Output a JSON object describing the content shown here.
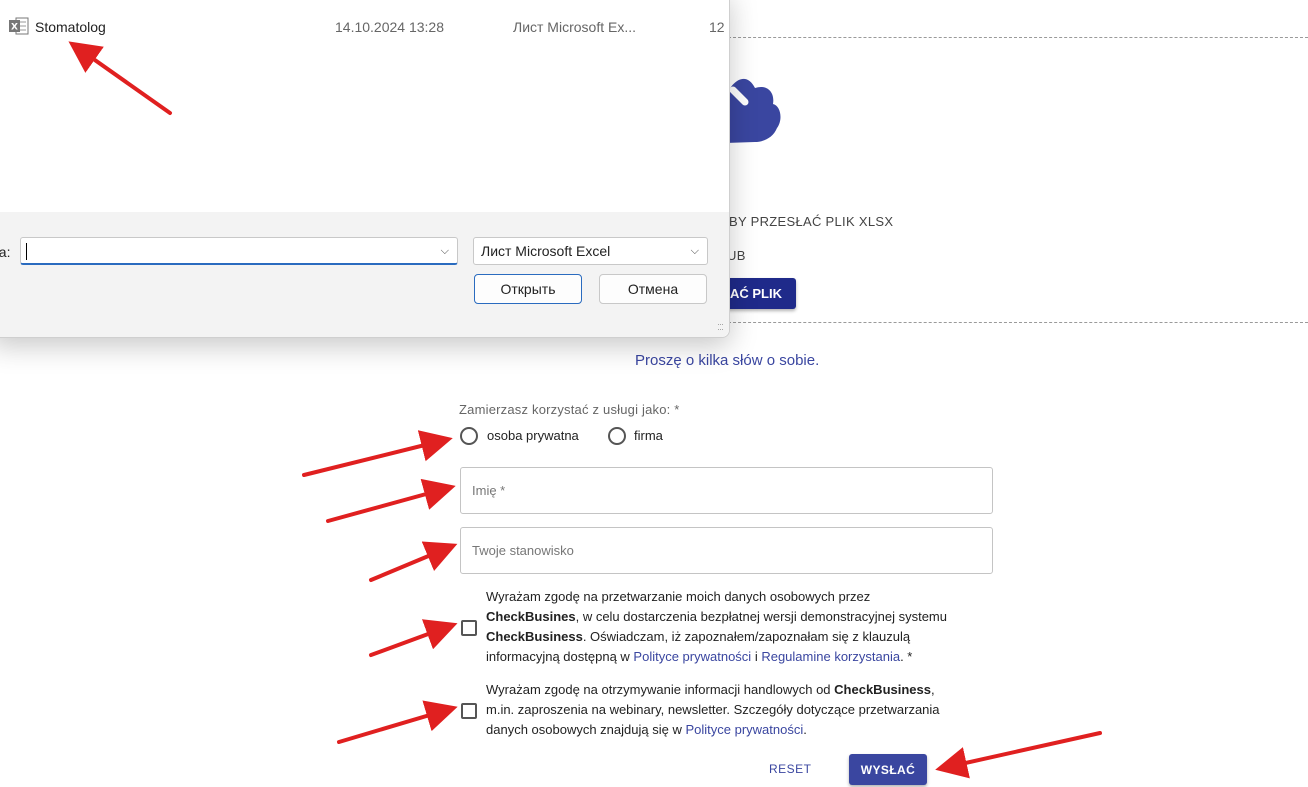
{
  "dialog": {
    "file": {
      "name": "Stomatolog",
      "date": "14.10.2024 13:28",
      "type": "Лист Microsoft Ex...",
      "size": "12"
    },
    "filename_label": "na:",
    "filename_value": "",
    "filetype_filter": "Лист Microsoft Excel",
    "open_button": "Открыть",
    "cancel_button": "Отмена"
  },
  "upload": {
    "instruction": "BY PRZESŁAĆ PLIK XLSX",
    "or_text": "UB",
    "button_label": "DAĆ PLIK"
  },
  "form": {
    "intro": "Proszę o kilka słów o sobie.",
    "usage_question": "Zamierzasz korzystać z usługi jako: *",
    "options": [
      "osoba prywatna",
      "firma"
    ],
    "name_placeholder": "Imię *",
    "position_placeholder": "Twoje stanowisko",
    "consent1": {
      "t1": "Wyrażam zgodę na przetwarzanie moich danych osobowych przez",
      "b1": "CheckBusines",
      "t2": ", w celu dostarczenia bezpłatnej wersji demonstracyjnej systemu",
      "b2": "CheckBusiness",
      "t3": ". Oświadczam, iż zapoznałem/zapoznałam się z klauzulą",
      "t4": "informacyjną dostępną w ",
      "link1": "Polityce prywatności",
      "t5": " i ",
      "link2": "Regulamine korzystania",
      "t6": ". *"
    },
    "consent2": {
      "t1": "Wyrażam zgodę na otrzymywanie informacji handlowych od ",
      "b1": "CheckBusiness",
      "t2": ",",
      "t3": "m.in. zaproszenia na webinary, newsletter. Szczegóły dotyczące przetwarzania",
      "t4": "danych osobowych znajdują się w ",
      "link1": "Polityce prywatności",
      "t5": "."
    },
    "reset_label": "RESET",
    "submit_label": "WYSŁAĆ"
  },
  "colors": {
    "accent": "#3a46a0",
    "upload_button": "#1f2a8a",
    "cloud": "#3a46a0",
    "annotation_arrow": "#e02020"
  },
  "icons": [
    "excel-file-icon",
    "cloud-upload-icon",
    "chevron-down-icon",
    "resize-grip-icon"
  ]
}
